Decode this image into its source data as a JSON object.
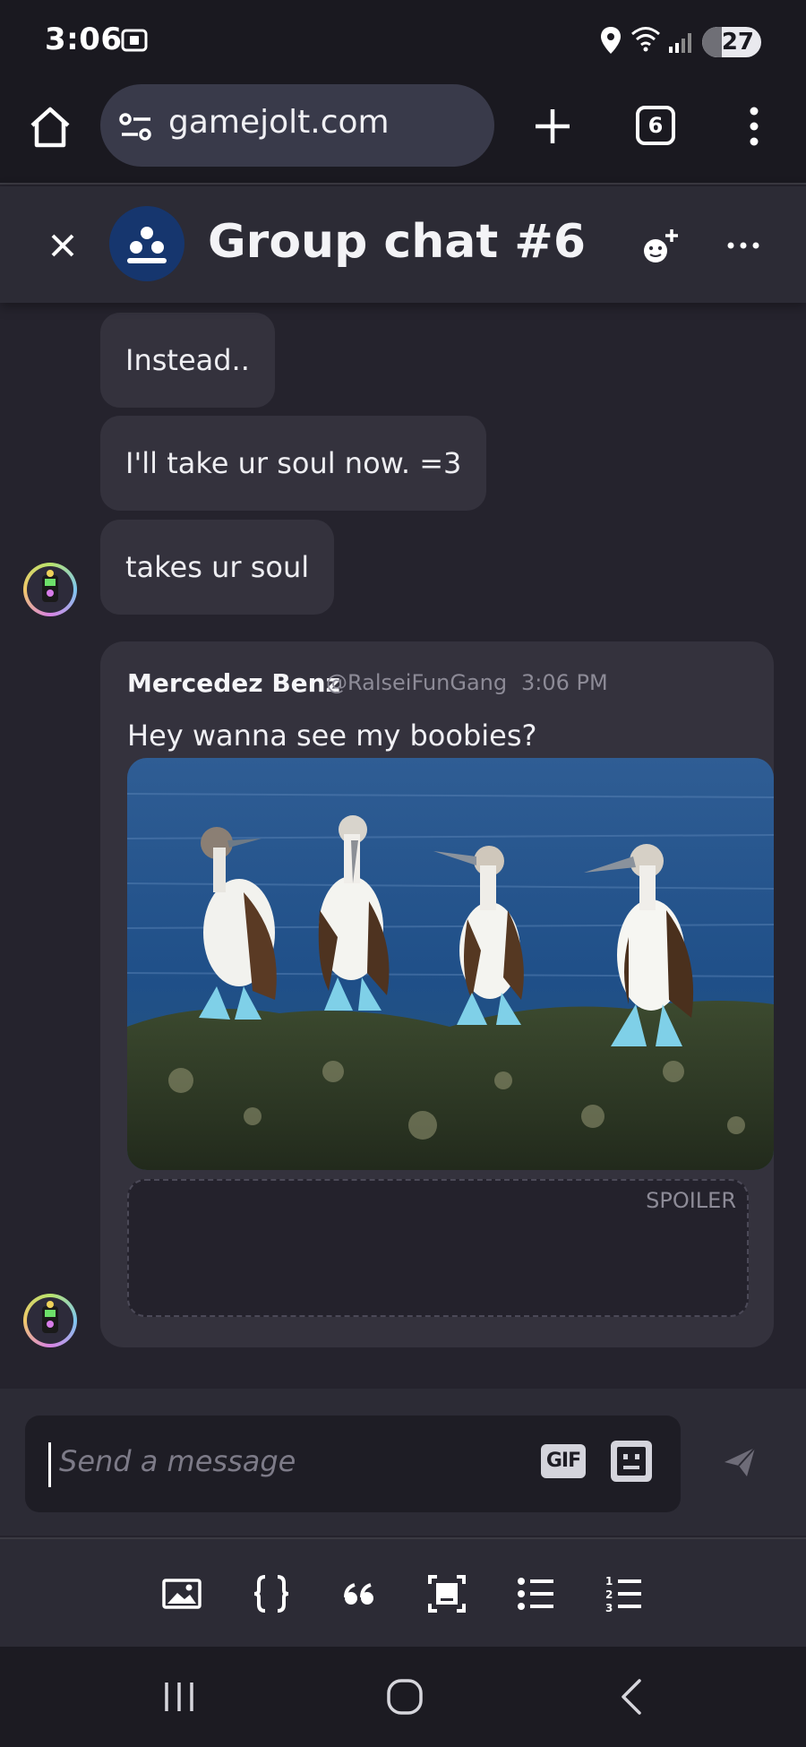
{
  "status_bar": {
    "time": "3:06",
    "battery": "27",
    "icons": [
      "screenshot-icon",
      "location-icon",
      "wifi-icon",
      "signal-icon",
      "battery-icon"
    ]
  },
  "browser": {
    "url": "gamejolt.com",
    "tab_count": "6"
  },
  "chat": {
    "title": "Group chat #6...",
    "messages": [
      {
        "text": "Instead.."
      },
      {
        "text": "I'll take ur soul now. =3"
      },
      {
        "text": "takes ur soul"
      }
    ],
    "card": {
      "author": "Mercedez Benz",
      "handle": "@RalseiFunGang",
      "time": "3:06 PM",
      "text": "Hey wanna see my boobies?",
      "spoiler_label": "SPOILER"
    }
  },
  "composer": {
    "placeholder": "Send a message",
    "gif_label": "GIF"
  },
  "toolbar": {
    "icons": [
      "image-icon",
      "code-block-icon",
      "quote-icon",
      "spoiler-icon",
      "bullet-list-icon",
      "numbered-list-icon"
    ]
  },
  "colors": {
    "background": "#25232d",
    "bubble": "#34323d",
    "header": "#2c2b35",
    "accent_avatar": "#16366e"
  }
}
